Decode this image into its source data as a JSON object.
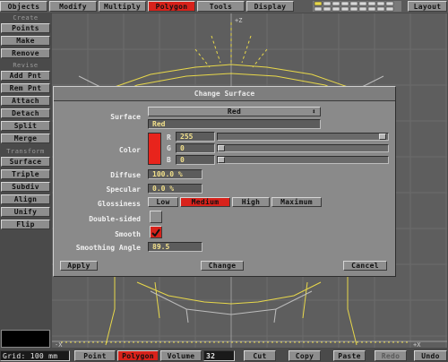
{
  "menu": {
    "tabs": [
      "Objects",
      "Modify",
      "Multiply",
      "Polygon",
      "Tools",
      "Display"
    ],
    "active": "Polygon",
    "layout": "Layout"
  },
  "toolbar": {
    "create_header": "Create",
    "create": [
      "Points",
      "Make",
      "Remove"
    ],
    "revise_header": "Revise",
    "revise": [
      "Add Pnt",
      "Rem Pnt",
      "Attach",
      "Detach",
      "Split",
      "Merge"
    ],
    "transform_header": "Transform",
    "transform": [
      "Surface",
      "Triple",
      "Subdiv",
      "Align",
      "Unify",
      "Flip"
    ]
  },
  "viewport": {
    "top_axis": "+Z",
    "bottom_left_axis": "-X",
    "bottom_right_axis": "+X",
    "colors": {
      "wire_selected": "#e8d84a",
      "wire_normal": "#bdbdbd",
      "grid": "#6e6e6e"
    }
  },
  "dialog": {
    "title": "Change Surface",
    "surface_label": "Surface",
    "surface_value": "Red",
    "surface_name": "Red",
    "color_label": "Color",
    "color_swatch": "#e8241c",
    "channels": [
      {
        "name": "R",
        "value": "255",
        "level": 1.0
      },
      {
        "name": "G",
        "value": "0",
        "level": 0.0
      },
      {
        "name": "B",
        "value": "0",
        "level": 0.0
      }
    ],
    "diffuse_label": "Diffuse",
    "diffuse_value": "100.0 %",
    "specular_label": "Specular",
    "specular_value": "0.0 %",
    "glossiness_label": "Glossiness",
    "glossiness_options": [
      "Low",
      "Medium",
      "High",
      "Maximum"
    ],
    "glossiness_selected": "Medium",
    "double_sided_label": "Double-sided",
    "double_sided_checked": false,
    "smooth_label": "Smooth",
    "smooth_checked": true,
    "smoothing_angle_label": "Smoothing Angle",
    "smoothing_angle_value": "89.5",
    "apply_label": "Apply",
    "change_label": "Change",
    "cancel_label": "Cancel"
  },
  "status": {
    "grid": "Grid: 100 mm",
    "modes": [
      "Point",
      "Polygon",
      "Volume"
    ],
    "active_mode": "Polygon",
    "count": "32",
    "actions": [
      "Cut",
      "Copy",
      "Paste",
      "Redo",
      "Undo"
    ],
    "disabled_action": "Redo"
  }
}
